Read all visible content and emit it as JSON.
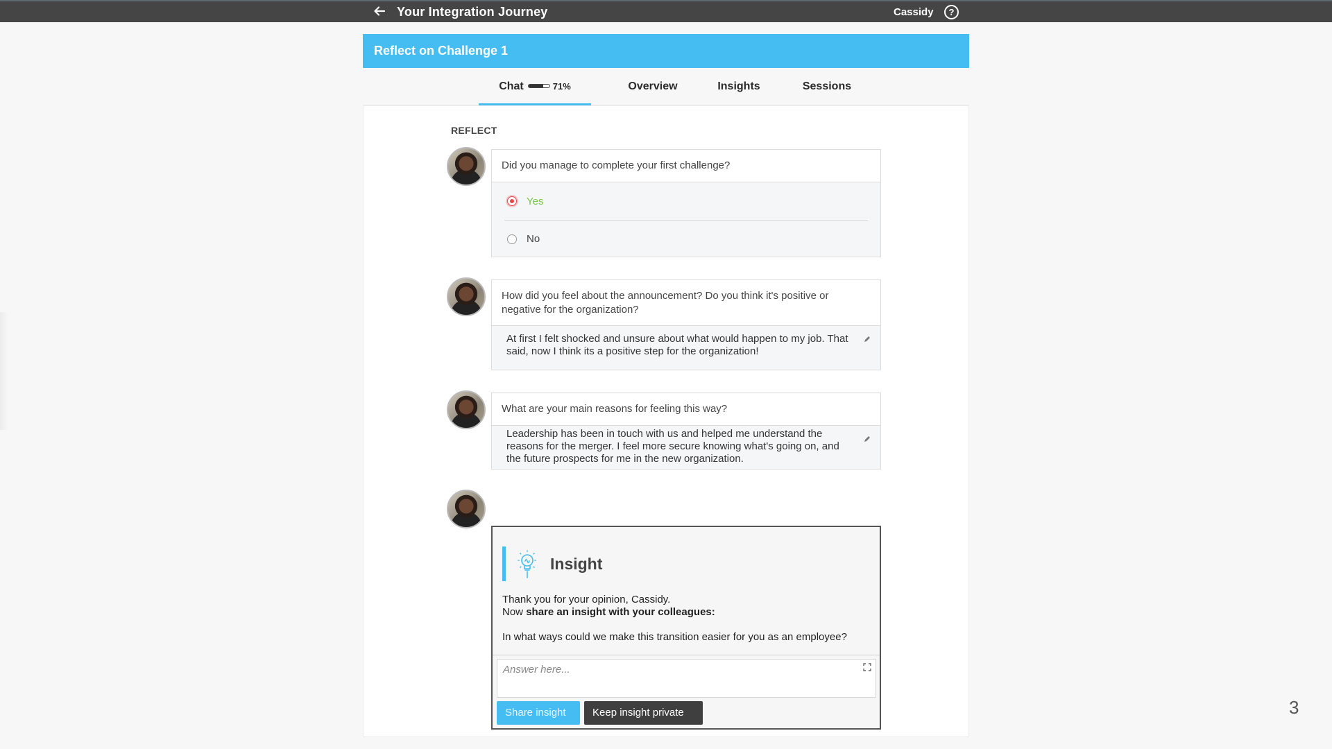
{
  "topbar": {
    "back_icon": "arrow-left-icon",
    "title": "Your Integration Journey",
    "user_name": "Cassidy",
    "help_icon": "question-circle-icon",
    "help_glyph": "?"
  },
  "challenge": {
    "title": "Reflect on Challenge 1"
  },
  "tabs": [
    {
      "label": "Chat",
      "active": true,
      "progress_percent": 71,
      "progress_label": "71%"
    },
    {
      "label": "Overview",
      "active": false
    },
    {
      "label": "Insights",
      "active": false
    },
    {
      "label": "Sessions",
      "active": false
    }
  ],
  "section_label": "REFLECT",
  "messages": [
    {
      "question": "Did you manage to complete your first challenge?",
      "options": [
        {
          "label": "Yes",
          "selected": true
        },
        {
          "label": "No",
          "selected": false
        }
      ]
    },
    {
      "question": "How did you feel about the announcement? Do you think it's positive or negative for the organization?",
      "answer": "At first I felt shocked and unsure about what would happen to my job. That said, now I think its a positive step for the organization!"
    },
    {
      "question": "What are your main reasons for feeling this way?",
      "answer": "Leadership has been in touch with us and helped me understand the reasons for the merger. I feel more secure knowing what's going on, and the future prospects for me in the new organization."
    }
  ],
  "insight": {
    "title": "Insight",
    "icon": "lightbulb-icon",
    "thanks": "Thank you for your opinion, Cassidy.",
    "prompt_prefix": "Now ",
    "prompt_bold": "share an insight with your colleagues:",
    "question": "In what ways could we make this transition easier for you as an employee?",
    "answer_placeholder": "Answer here...",
    "answer_value": "",
    "share_label": "Share insight",
    "private_label": "Keep insight private"
  },
  "colors": {
    "accent": "#45bdf2",
    "topbar": "#454545",
    "selected_radio": "#e8474d",
    "selected_option_text": "#7cc14a",
    "private_button": "#3f3f3f"
  },
  "page_number": "3"
}
